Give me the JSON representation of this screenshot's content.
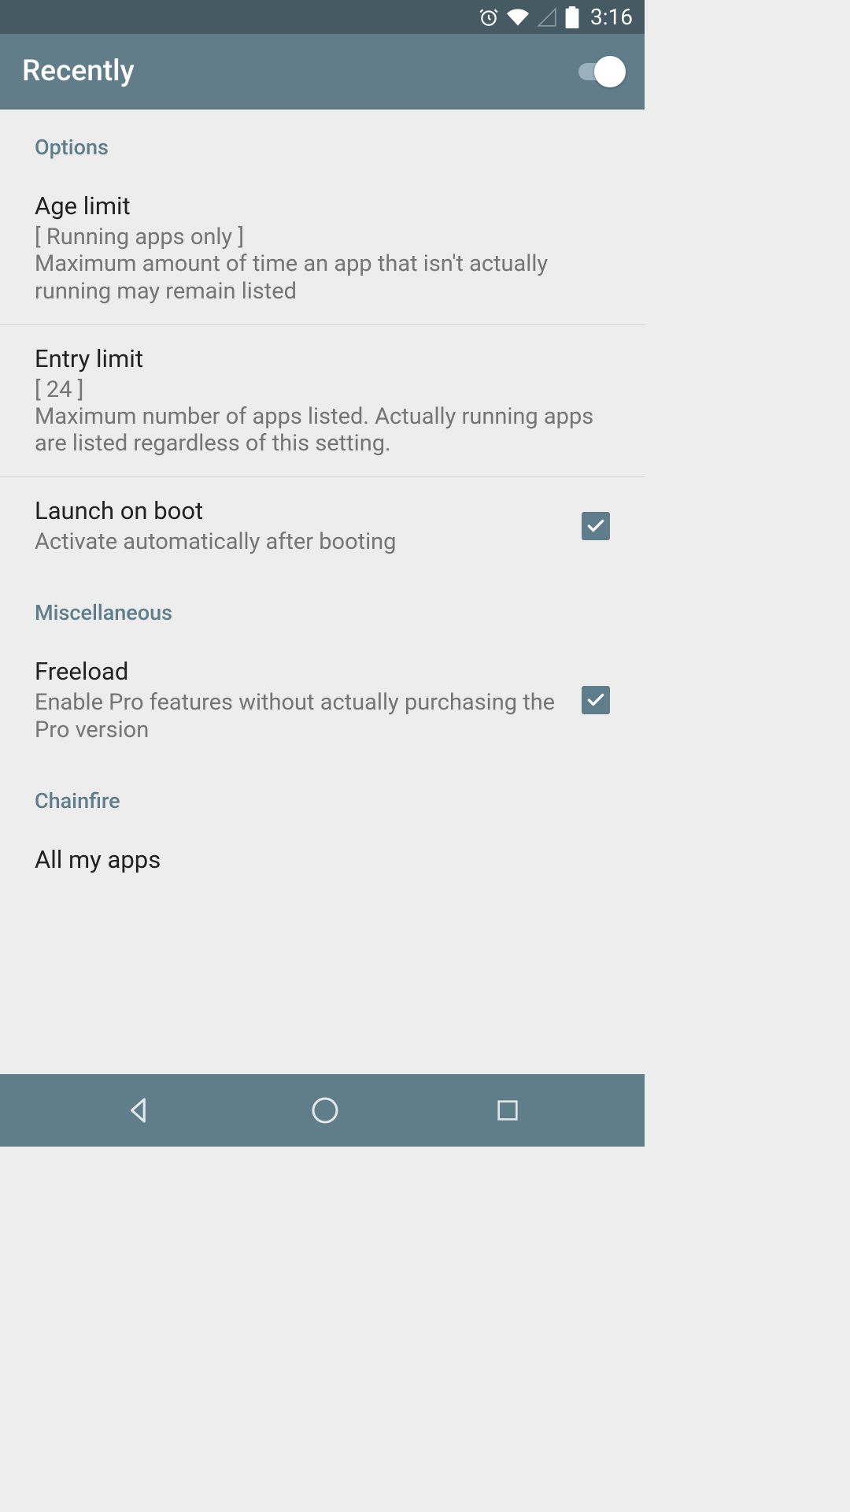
{
  "status_bar": {
    "time": "3:16"
  },
  "header": {
    "title": "Recently",
    "toggle_on": true
  },
  "sections": {
    "options": {
      "header": "Options",
      "items": [
        {
          "id": "age-limit",
          "title": "Age limit",
          "value": "[ Running apps only ]",
          "description": "Maximum amount of time an app that isn't actually running may remain listed"
        },
        {
          "id": "entry-limit",
          "title": "Entry limit",
          "value": "[ 24 ]",
          "description": "Maximum number of apps listed. Actually running apps are listed regardless of this setting."
        },
        {
          "id": "launch-on-boot",
          "title": "Launch on boot",
          "description": "Activate automatically after booting",
          "checkbox": true,
          "checked": true
        }
      ]
    },
    "miscellaneous": {
      "header": "Miscellaneous",
      "items": [
        {
          "id": "freeload",
          "title": "Freeload",
          "description": "Enable Pro features without actually purchasing the Pro version",
          "checkbox": true,
          "checked": true
        }
      ]
    },
    "chainfire": {
      "header": "Chainfire",
      "items": [
        {
          "id": "all-my-apps",
          "title": "All my apps"
        }
      ]
    }
  }
}
